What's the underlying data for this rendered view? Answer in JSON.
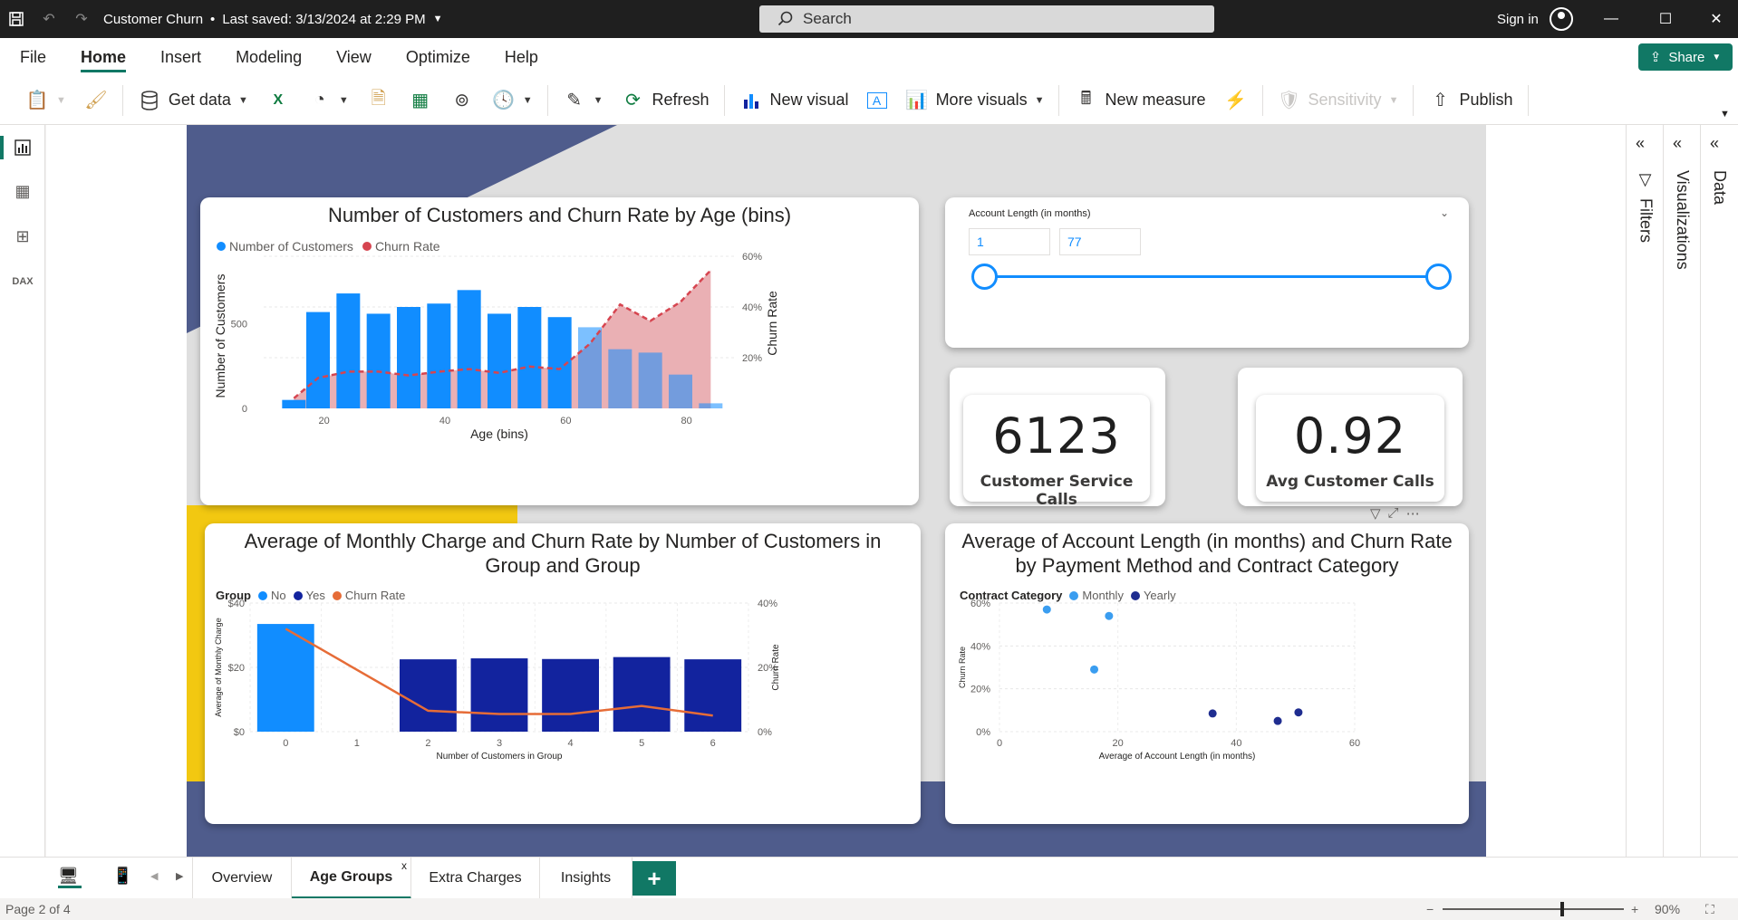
{
  "titlebar": {
    "title": "Customer Churn",
    "saved": "Last saved: 3/13/2024 at 2:29 PM",
    "search_placeholder": "Search",
    "signin": "Sign in"
  },
  "menu": [
    "File",
    "Home",
    "Insert",
    "Modeling",
    "View",
    "Optimize",
    "Help"
  ],
  "share_label": "Share",
  "ribbon": {
    "get_data": "Get data",
    "refresh": "Refresh",
    "new_visual": "New visual",
    "more_visuals": "More visuals",
    "new_measure": "New measure",
    "sensitivity": "Sensitivity",
    "publish": "Publish"
  },
  "panes": {
    "filters": "Filters",
    "visualizations": "Visualizations",
    "data": "Data"
  },
  "tabs": [
    "Overview",
    "Age Groups",
    "Extra Charges",
    "Insights"
  ],
  "status": {
    "page": "Page 2 of 4",
    "zoom": "90%"
  },
  "slicer": {
    "title": "Account Length (in months)",
    "min": "1",
    "max": "77",
    "value_low": 1,
    "value_high": 77
  },
  "kpis": [
    {
      "value": "6123",
      "label": "Customer Service Calls"
    },
    {
      "value": "0.92",
      "label": "Avg Customer Calls"
    }
  ],
  "chart_data": [
    {
      "type": "bar",
      "title": "Number of Customers and Churn Rate by Age (bins)",
      "xlabel": "Age (bins)",
      "ylabel": "Number of Customers",
      "y2label": "Churn Rate",
      "legend": [
        "Number of Customers",
        "Churn Rate"
      ],
      "x": [
        15,
        19,
        24,
        29,
        34,
        39,
        44,
        49,
        54,
        59,
        64,
        69,
        74,
        79,
        84
      ],
      "series": [
        {
          "name": "Number of Customers",
          "values": [
            50,
            570,
            680,
            560,
            600,
            620,
            700,
            560,
            600,
            540,
            480,
            350,
            330,
            200,
            30
          ]
        },
        {
          "name": "Churn Rate",
          "values": [
            0.04,
            0.12,
            0.145,
            0.145,
            0.13,
            0.145,
            0.155,
            0.14,
            0.165,
            0.155,
            0.255,
            0.41,
            0.345,
            0.42,
            0.545
          ]
        }
      ],
      "x_ticks": [
        "20",
        "40",
        "60",
        "80"
      ],
      "y_ticks": [
        "0",
        "500"
      ],
      "y2_ticks": [
        "20%",
        "40%",
        "60%"
      ],
      "ylim": [
        0,
        900
      ],
      "y2lim": [
        0,
        0.6
      ]
    },
    {
      "type": "bar",
      "title": "Average of Monthly Charge and Churn Rate by Number of Customers in Group and Group",
      "xlabel": "Number of Customers in Group",
      "ylabel": "Average of Monthly Charge",
      "y2label": "Churn Rate",
      "legend_title": "Group",
      "legend": [
        "No",
        "Yes",
        "Churn Rate"
      ],
      "categories": [
        "0",
        "1",
        "2",
        "3",
        "4",
        "5",
        "6"
      ],
      "series": [
        {
          "name": "No",
          "values": [
            33.5,
            null,
            null,
            null,
            null,
            null,
            null
          ]
        },
        {
          "name": "Yes",
          "values": [
            null,
            null,
            22.5,
            22.8,
            22.6,
            23.2,
            22.5
          ]
        },
        {
          "name": "Churn Rate",
          "values": [
            0.32,
            null,
            0.065,
            0.055,
            0.055,
            0.08,
            0.05
          ]
        }
      ],
      "y_ticks": [
        "$0",
        "$20",
        "$40"
      ],
      "y2_ticks": [
        "0%",
        "20%",
        "40%"
      ],
      "ylim": [
        0,
        40
      ],
      "y2lim": [
        0,
        0.4
      ]
    },
    {
      "type": "scatter",
      "title": "Average of Account Length (in months) and Churn Rate by Payment Method and Contract Category",
      "xlabel": "Average of Account Length (in months)",
      "ylabel": "Churn Rate",
      "legend_title": "Contract Category",
      "legend": [
        "Monthly",
        "Yearly"
      ],
      "series": [
        {
          "name": "Monthly",
          "points": [
            [
              8,
              0.57
            ],
            [
              18.5,
              0.54
            ],
            [
              16,
              0.29
            ]
          ]
        },
        {
          "name": "Yearly",
          "points": [
            [
              36,
              0.085
            ],
            [
              47,
              0.05
            ],
            [
              50.5,
              0.09
            ]
          ]
        }
      ],
      "x_ticks": [
        "0",
        "20",
        "40",
        "60"
      ],
      "y_ticks": [
        "0%",
        "20%",
        "40%",
        "60%"
      ],
      "xlim": [
        0,
        60
      ],
      "ylim": [
        0,
        0.6
      ]
    }
  ],
  "colors": {
    "accent": "#117865",
    "bar_blue": "#118dff",
    "dark_blue": "#12239e",
    "churn_red": "#d64550",
    "churn_fill": "#eab0b4",
    "orange": "#e66c37",
    "page_navy": "#4f5c8c",
    "page_yellow": "#f2c811"
  }
}
